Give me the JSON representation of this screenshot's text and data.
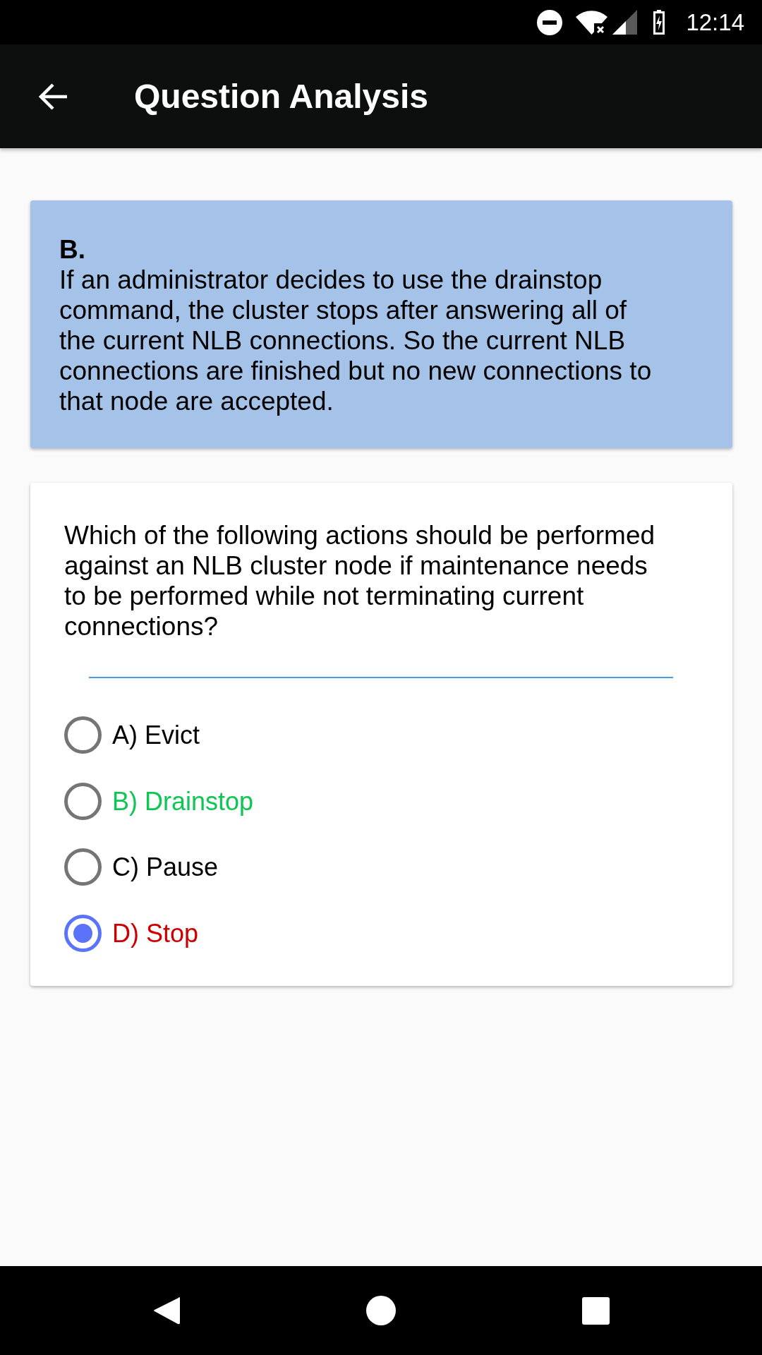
{
  "status_bar": {
    "time": "12:14"
  },
  "app_bar": {
    "title": "Question Analysis"
  },
  "explanation": {
    "answer": "B.",
    "text": "If an administrator decides to use the drainstop command, the cluster stops after answering all of the current NLB connections. So the current NLB connections are finished but no new connections to that node are accepted."
  },
  "question": {
    "text": "Which of the following actions should be performed against an NLB cluster node if maintenance needs to be performed while not terminating current connections?",
    "options": [
      {
        "label": "A) Evict",
        "selected": false,
        "correct": false
      },
      {
        "label": "B) Drainstop",
        "selected": false,
        "correct": true
      },
      {
        "label": "C) Pause",
        "selected": false,
        "correct": false
      },
      {
        "label": "D) Stop",
        "selected": true,
        "correct": false
      }
    ]
  }
}
